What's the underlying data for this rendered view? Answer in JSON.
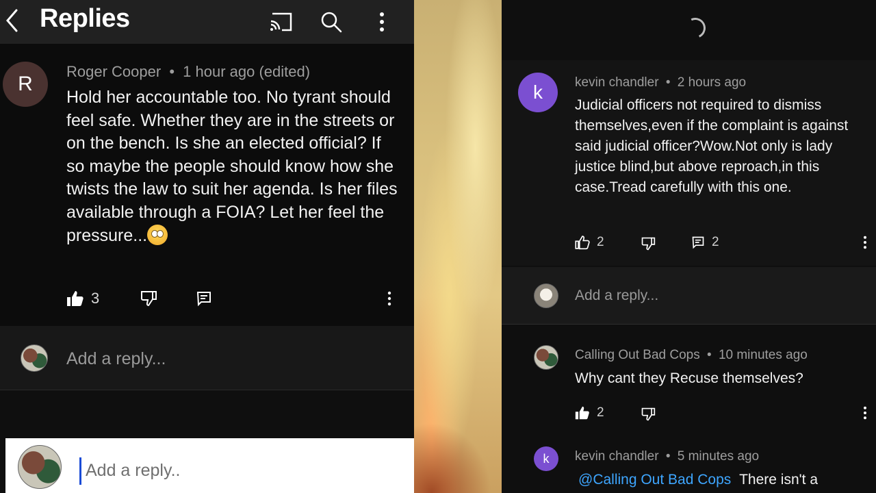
{
  "left": {
    "title": "Replies",
    "comment": {
      "avatar_letter": "R",
      "author": "Roger Cooper",
      "separator": "•",
      "time": "1 hour ago (edited)",
      "text": "Hold her accountable too. No tyrant should feel safe. Whether they are in the streets or on the bench. Is she an elected official? If so maybe the people should know how she twists the law to suit her agenda. Is her files available through a FOIA? Let her feel the pressure...",
      "emoji": "face-with-rolling-eyes",
      "likes": "3"
    },
    "reply_placeholder": "Add a reply...",
    "composer_placeholder": "Add a reply.."
  },
  "right": {
    "comment": {
      "avatar_letter": "k",
      "author": "kevin chandler",
      "separator": "•",
      "time": "2 hours ago",
      "text": "Judicial officers not required to dismiss themselves,even if the complaint is against said judicial officer?Wow.Not only is lady justice blind,but above reproach,in this case.Tread carefully with this one.",
      "likes": "2",
      "replies": "2"
    },
    "reply_placeholder": "Add a reply...",
    "reply1": {
      "author": "Calling Out Bad Cops",
      "separator": "•",
      "time": "10 minutes ago",
      "text": "Why cant they Recuse themselves?",
      "likes": "2"
    },
    "reply2": {
      "avatar_letter": "k",
      "author": "kevin chandler",
      "separator": "•",
      "time": "5 minutes ago",
      "mention": "@Calling Out Bad Cops",
      "text": "There isn't a"
    }
  },
  "colors": {
    "accent_link": "#3ea6ff",
    "avatar_purple": "#7b4fd1",
    "avatar_brown": "#4a3230"
  }
}
